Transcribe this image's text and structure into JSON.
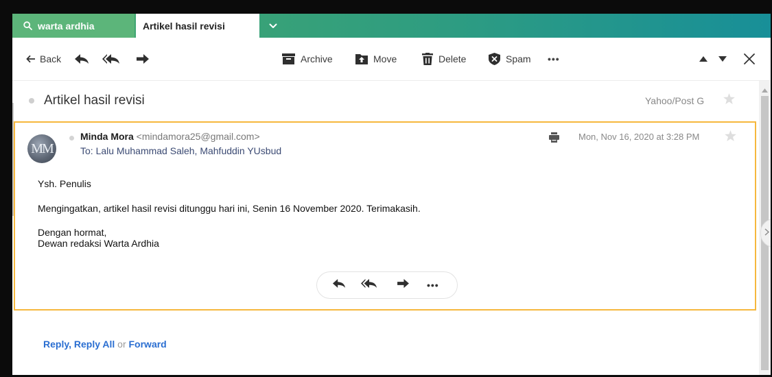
{
  "tabs": {
    "search_label": "warta ardhia",
    "active_label": "Artikel hasil revisi",
    "more_icon": "chevron-down-icon"
  },
  "toolbar": {
    "back_label": "Back",
    "archive_label": "Archive",
    "move_label": "Move",
    "delete_label": "Delete",
    "spam_label": "Spam",
    "more_label": "•••"
  },
  "message": {
    "subject": "Artikel hasil revisi",
    "folder": "Yahoo/Post G",
    "sender_name": "Minda Mora",
    "sender_email": "<mindamora25@gmail.com>",
    "to_line": "To: Lalu Muhammad Saleh,  Mahfuddin YUsbud",
    "avatar_initials": "MM",
    "date": "Mon, Nov 16, 2020 at 3:28 PM",
    "body_greeting": "Ysh. Penulis",
    "body_main": "Mengingatkan, artikel hasil revisi ditunggu hari ini, Senin 16 November 2020. Terimakasih.",
    "body_sign1": "Dengan hormat,",
    "body_sign2": "Dewan redaksi Warta Ardhia",
    "action_more": "•••"
  },
  "footer": {
    "reply": "Reply",
    "comma": ",",
    "reply_all": "Reply All",
    "or": "or",
    "forward": "Forward"
  },
  "colors": {
    "tab_green": "#5cb57a",
    "accent_border": "#f6b73c",
    "link_blue": "#2a6ed1"
  }
}
